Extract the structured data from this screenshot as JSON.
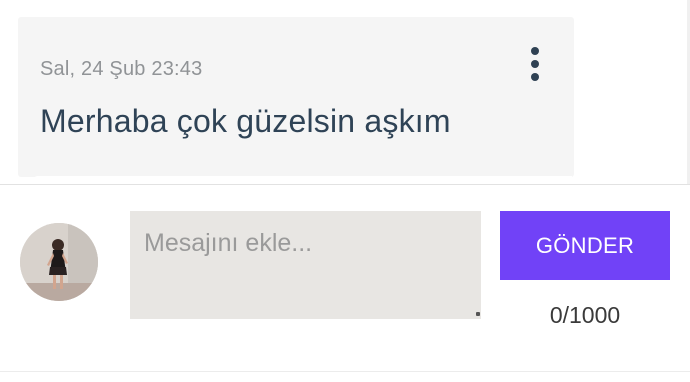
{
  "message": {
    "date": "Sal, 24 Şub 23:43",
    "text": "Merhaba çok güzelsin aşkım",
    "menu_icon": "more-vertical-icon"
  },
  "composer": {
    "placeholder": "Mesajını ekle...",
    "value": "",
    "send_label": "GÖNDER",
    "char_count": "0/1000",
    "accent_color": "#7142f7"
  },
  "avatar": {
    "icon": "user-photo"
  }
}
